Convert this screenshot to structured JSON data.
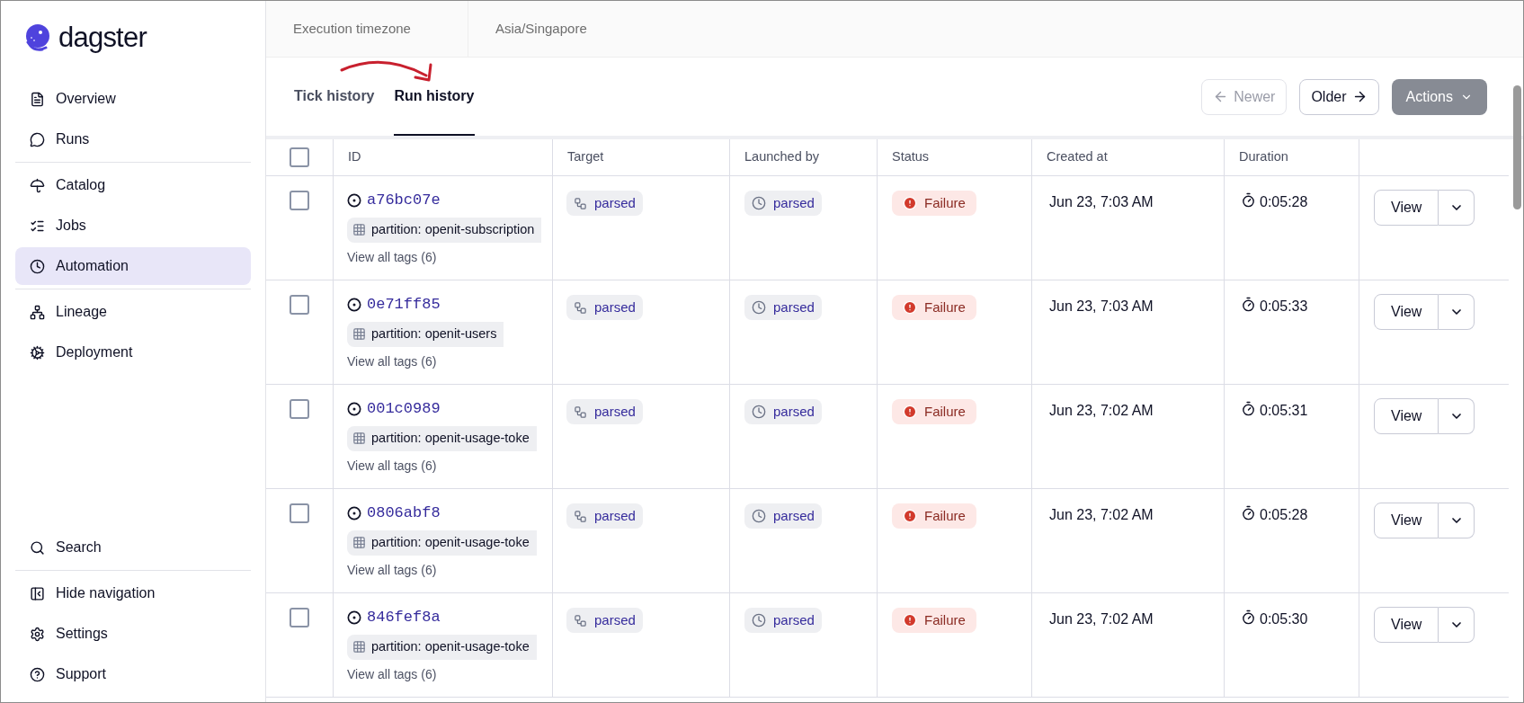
{
  "logo": {
    "text": "dagster"
  },
  "top_bar": {
    "label": "Execution timezone",
    "value": "Asia/Singapore"
  },
  "sidebar": {
    "top_groups": [
      {
        "items": [
          {
            "label": "Overview",
            "selected": false
          },
          {
            "label": "Runs",
            "selected": false
          }
        ]
      },
      {
        "items": [
          {
            "label": "Catalog",
            "selected": false
          },
          {
            "label": "Jobs",
            "selected": false
          },
          {
            "label": "Automation",
            "selected": true
          }
        ]
      },
      {
        "items": [
          {
            "label": "Lineage",
            "selected": false
          },
          {
            "label": "Deployment",
            "selected": false
          }
        ]
      }
    ],
    "bottom_groups": [
      {
        "items": [
          {
            "label": "Search",
            "selected": false
          }
        ]
      },
      {
        "items": [
          {
            "label": "Hide navigation",
            "selected": false
          },
          {
            "label": "Settings",
            "selected": false
          },
          {
            "label": "Support",
            "selected": false
          }
        ]
      }
    ]
  },
  "tabs": [
    {
      "label": "Tick history",
      "selected": false
    },
    {
      "label": "Run history",
      "selected": true
    }
  ],
  "pager": {
    "newer": {
      "label": "Newer",
      "disabled": true
    },
    "older": {
      "label": "Older",
      "disabled": false
    }
  },
  "actions": {
    "label": "Actions",
    "disabled": true
  },
  "table": {
    "columns": [
      "ID",
      "Target",
      "Launched by",
      "Status",
      "Created at",
      "Duration"
    ],
    "all_checked": false,
    "rows": [
      {
        "checked": false,
        "id": "a76bc07e",
        "tag": "partition: openit-subscription",
        "tags_link": "View all tags (6)",
        "target": "parsed",
        "launched_by": "parsed",
        "status": "Failure",
        "kind": "failure",
        "created_at": "Jun 23, 7:03 AM",
        "duration": "0:05:28",
        "view": "View"
      },
      {
        "checked": false,
        "id": "0e71ff85",
        "tag": "partition: openit-users",
        "tags_link": "View all tags (6)",
        "target": "parsed",
        "launched_by": "parsed",
        "status": "Failure",
        "kind": "failure",
        "created_at": "Jun 23, 7:03 AM",
        "duration": "0:05:33",
        "view": "View"
      },
      {
        "checked": false,
        "id": "001c0989",
        "tag": "partition: openit-usage-toke",
        "tags_link": "View all tags (6)",
        "target": "parsed",
        "launched_by": "parsed",
        "status": "Failure",
        "kind": "failure",
        "created_at": "Jun 23, 7:02 AM",
        "duration": "0:05:31",
        "view": "View"
      },
      {
        "checked": false,
        "id": "0806abf8",
        "tag": "partition: openit-usage-toke",
        "tags_link": "View all tags (6)",
        "target": "parsed",
        "launched_by": "parsed",
        "status": "Failure",
        "kind": "failure",
        "created_at": "Jun 23, 7:02 AM",
        "duration": "0:05:28",
        "view": "View"
      },
      {
        "checked": false,
        "id": "846fef8a",
        "tag": "partition: openit-usage-toke",
        "tags_link": "View all tags (6)",
        "target": "parsed",
        "launched_by": "parsed",
        "status": "Failure",
        "kind": "failure",
        "created_at": "Jun 23, 7:02 AM",
        "duration": "0:05:30",
        "view": "View"
      }
    ]
  }
}
